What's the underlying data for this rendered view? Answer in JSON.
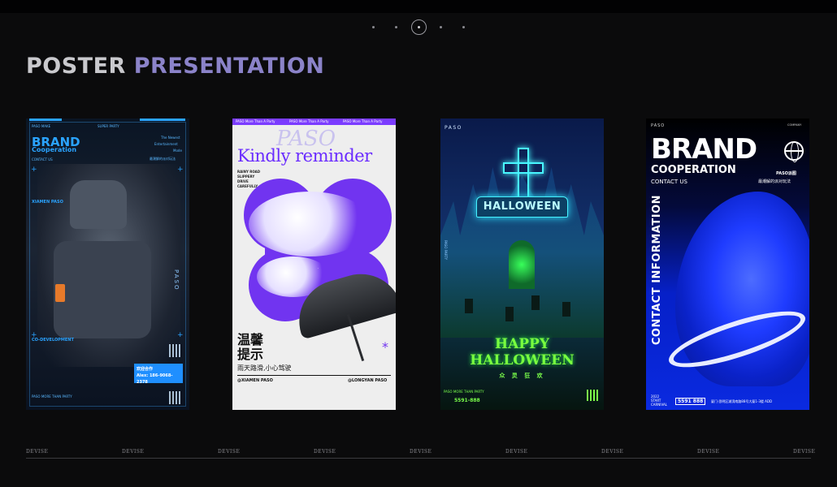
{
  "header": {
    "title_word1": "POSTER",
    "title_word2": "PRESENTATION",
    "pager": {
      "count": 5,
      "active_index": 2
    }
  },
  "posters": [
    {
      "brand": "BRAND",
      "cooperation": "Cooperation",
      "contact_us": "CONTACT US",
      "top_left": "PASO MAKE",
      "top_mid": "SUPER PARTY",
      "top_right": "The Newest",
      "right_lines": [
        "Entertainment",
        "Mode"
      ],
      "cn_tag": "最潮解的派对玩法",
      "location": "XIAMEN PASO",
      "codev": "CO-DEVELOPMENT",
      "paso_vertical": "PASO",
      "contact_box_line1": "欢迎合作",
      "contact_box_line2": "Alex: 186-9068-2378",
      "footer": "PASO MORE THAN PARTY"
    },
    {
      "strip": [
        "PASO More Than A Party",
        "PASO More Than A Party",
        "PASO More Than A Party"
      ],
      "script": "PASO",
      "headline": "Kindly reminder",
      "side_lines": [
        "RAINY ROAD",
        "SLIPPERY",
        "DRIVE",
        "CAREFULLY"
      ],
      "cn_title_1": "温馨",
      "cn_title_2": "提示",
      "cn_sub": "雨天路滑,小心驾驶",
      "star": "*",
      "left_contact": "@XIAMEN PASO",
      "right_contact": "@LONGYAN PASO"
    },
    {
      "paso": "PASO",
      "sign": "HALLOWEEN",
      "happy": "HAPPY",
      "halloween": "HALLOWEEN",
      "cn": "众 灵 狂 欢",
      "footer": "PASO MORE THAN PARTY",
      "phone": "5591-888",
      "side": "PASO PARTY"
    },
    {
      "paso": "PASO",
      "top_right": "COMPANY",
      "brand": "BRAND",
      "cooperation": "COOPERATION",
      "contact_us": "CONTACT US",
      "paso_cn": "PASO派图",
      "cn_sub": "最潮解的派对玩法",
      "vertical": "CONTACT INFORMATION",
      "year_lines": [
        "2022",
        "START",
        "CARNIVAL"
      ],
      "phone": "5591 888",
      "address": "厦门·思明区湖滨南路88号大厦1-3楼 ADD"
    }
  ],
  "footer_labels": [
    "DEVISE",
    "DEVISE",
    "DEVISE",
    "DEVISE",
    "DEVISE",
    "DEVISE",
    "DEVISE",
    "DEVISE",
    "DEVISE"
  ],
  "colors": {
    "background": "#0b0b0c",
    "title_gray": "#c9c9cd",
    "title_purple": "#8b83c9",
    "poster2_purple": "#7134f0",
    "poster3_green": "#79ff3f",
    "poster4_blue": "#0a2ae0"
  }
}
